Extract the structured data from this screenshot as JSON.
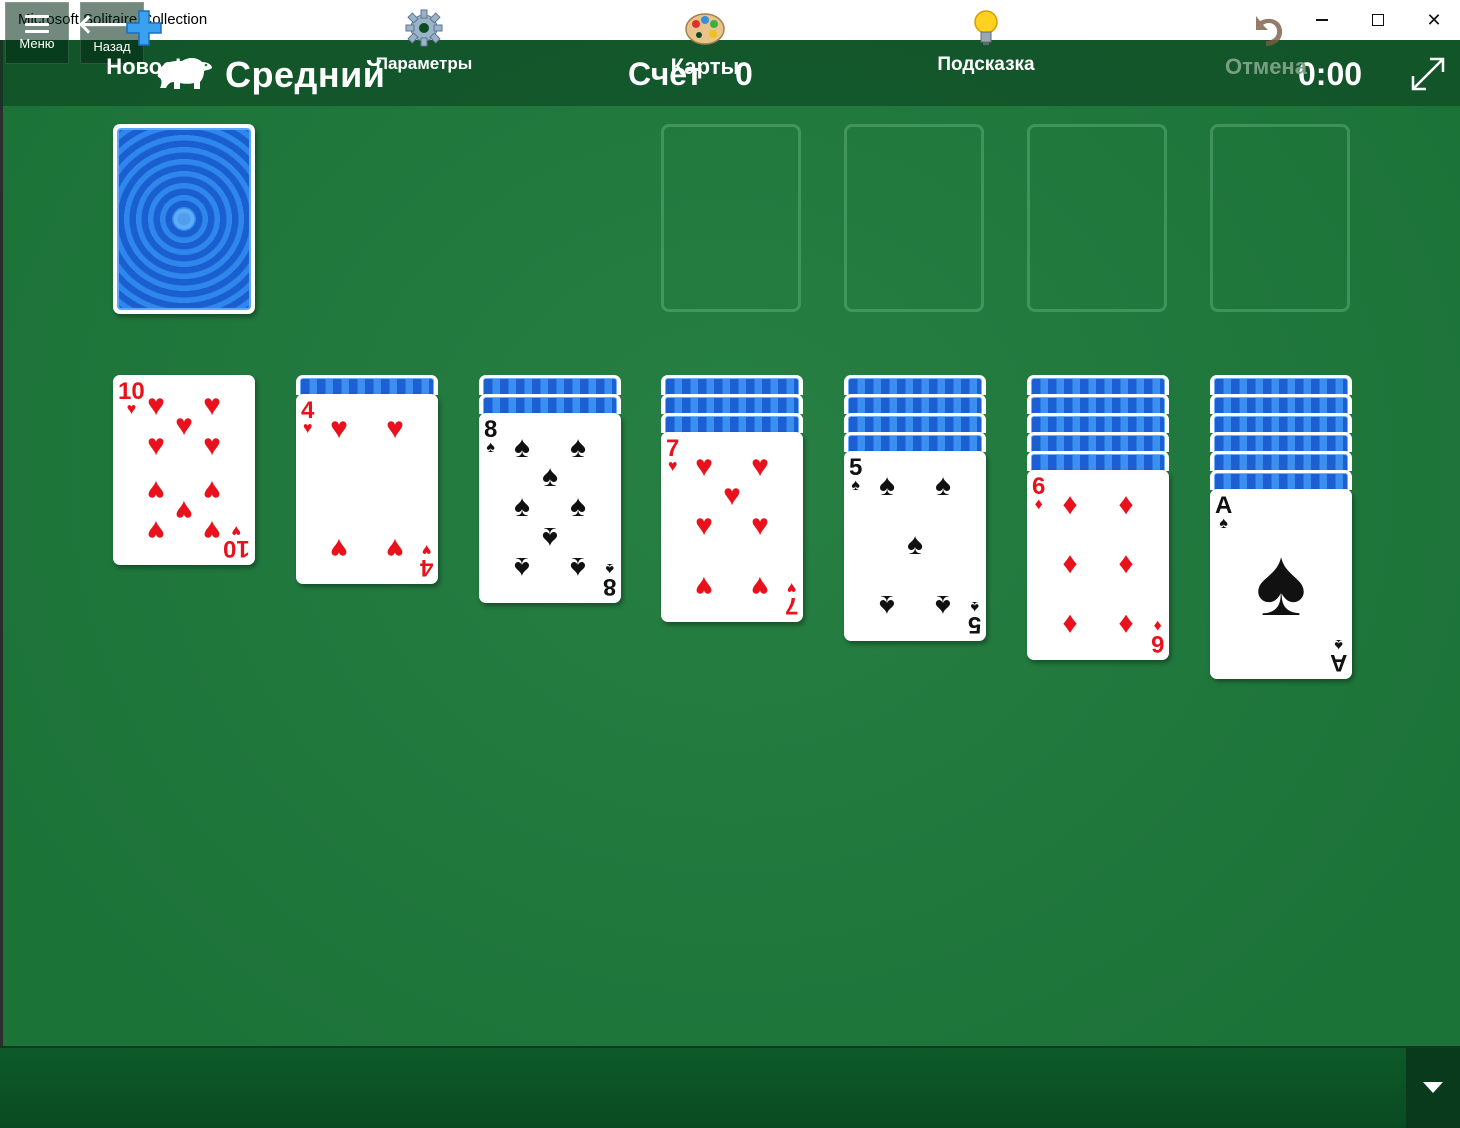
{
  "window": {
    "title": "Microsoft Solitaire Collection",
    "minimize_icon": "minimize-icon",
    "maximize_icon": "maximize-icon",
    "close_icon": "close-icon"
  },
  "topbar": {
    "menu_label": "Меню",
    "back_label": "Назад",
    "difficulty": "Средний",
    "score_label": "Счет",
    "score_value": "0",
    "timer": "0:00",
    "fullscreen_icon": "fullscreen-icon"
  },
  "colors": {
    "felt": "#1e7a3c",
    "red_suit": "#e8111c",
    "card_back": "#1e6ad8"
  },
  "stock": {
    "face_down": true
  },
  "foundations": [
    "empty",
    "empty",
    "empty",
    "empty"
  ],
  "tableau": [
    {
      "hidden": 0,
      "rank": "10",
      "suit": "♥",
      "color": "red"
    },
    {
      "hidden": 1,
      "rank": "4",
      "suit": "♥",
      "color": "red"
    },
    {
      "hidden": 2,
      "rank": "8",
      "suit": "♠",
      "color": "black"
    },
    {
      "hidden": 3,
      "rank": "7",
      "suit": "♥",
      "color": "red"
    },
    {
      "hidden": 4,
      "rank": "5",
      "suit": "♠",
      "color": "black"
    },
    {
      "hidden": 5,
      "rank": "6",
      "suit": "♦",
      "color": "red"
    },
    {
      "hidden": 6,
      "rank": "A",
      "suit": "♠",
      "color": "black"
    }
  ],
  "bottombar": {
    "new_label": "Новое!",
    "params_label": "Параметры",
    "cards_label": "Карты",
    "hint_label": "Подсказка",
    "undo_label": "Отмена"
  }
}
